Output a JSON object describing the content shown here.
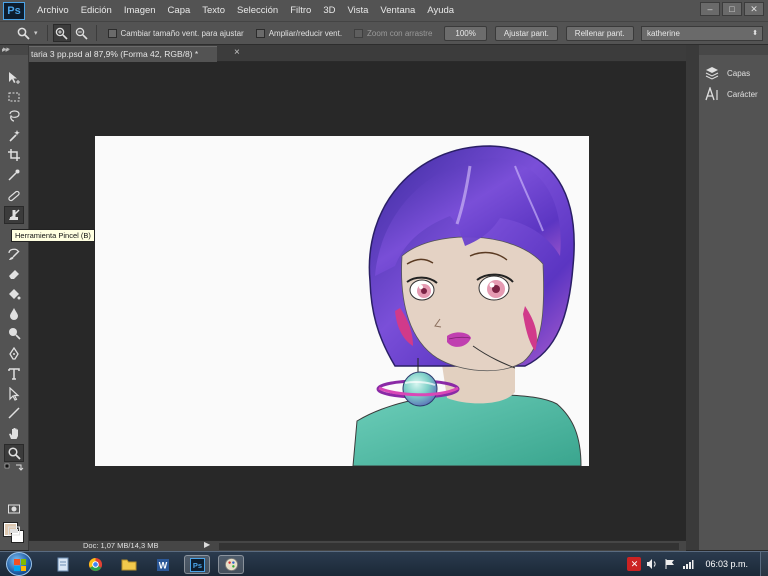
{
  "menubar": {
    "logo": "Ps",
    "items": [
      "Archivo",
      "Edición",
      "Imagen",
      "Capa",
      "Texto",
      "Selección",
      "Filtro",
      "3D",
      "Vista",
      "Ventana",
      "Ayuda"
    ],
    "window_controls": [
      "–",
      "□",
      "✕"
    ]
  },
  "options": {
    "resize_windows_label": "Cambiar tamaño vent. para ajustar",
    "zoom_all_label": "Ampliar/reducir vent.",
    "scrubby_zoom_label": "Zoom con arrastre",
    "zoom_100_label": "100%",
    "fit_screen_label": "Ajustar pant.",
    "fill_screen_label": "Rellenar pant.",
    "workspace": "katherine"
  },
  "document": {
    "tab_title": "taria 3 pp.psd al 87,9% (Forma 42, RGB/8) *",
    "close_glyph": "×",
    "status": "Doc: 1,07 MB/14,3 MB"
  },
  "tooltip": "Herramienta Pincel (B)",
  "dock": {
    "layers_label": "Capas",
    "character_label": "Carácter"
  },
  "taskbar": {
    "clock": "06:03 p.m."
  },
  "colors": {
    "foreground": "#dec8b0",
    "background": "#ffffff",
    "ui_panel": "#535353",
    "canvas_bg": "#282828",
    "ps_blue": "#4aa3e8"
  },
  "icons": {
    "tools": [
      "move-icon",
      "marquee-icon",
      "lasso-icon",
      "magic-wand-icon",
      "crop-icon",
      "eyedropper-icon",
      "healing-brush-icon",
      "brush-icon",
      "clone-stamp-icon",
      "history-brush-icon",
      "eraser-icon",
      "paint-bucket-icon",
      "blur-icon",
      "dodge-icon",
      "pen-icon",
      "type-icon",
      "path-selection-icon",
      "line-icon",
      "hand-icon",
      "zoom-icon"
    ]
  }
}
